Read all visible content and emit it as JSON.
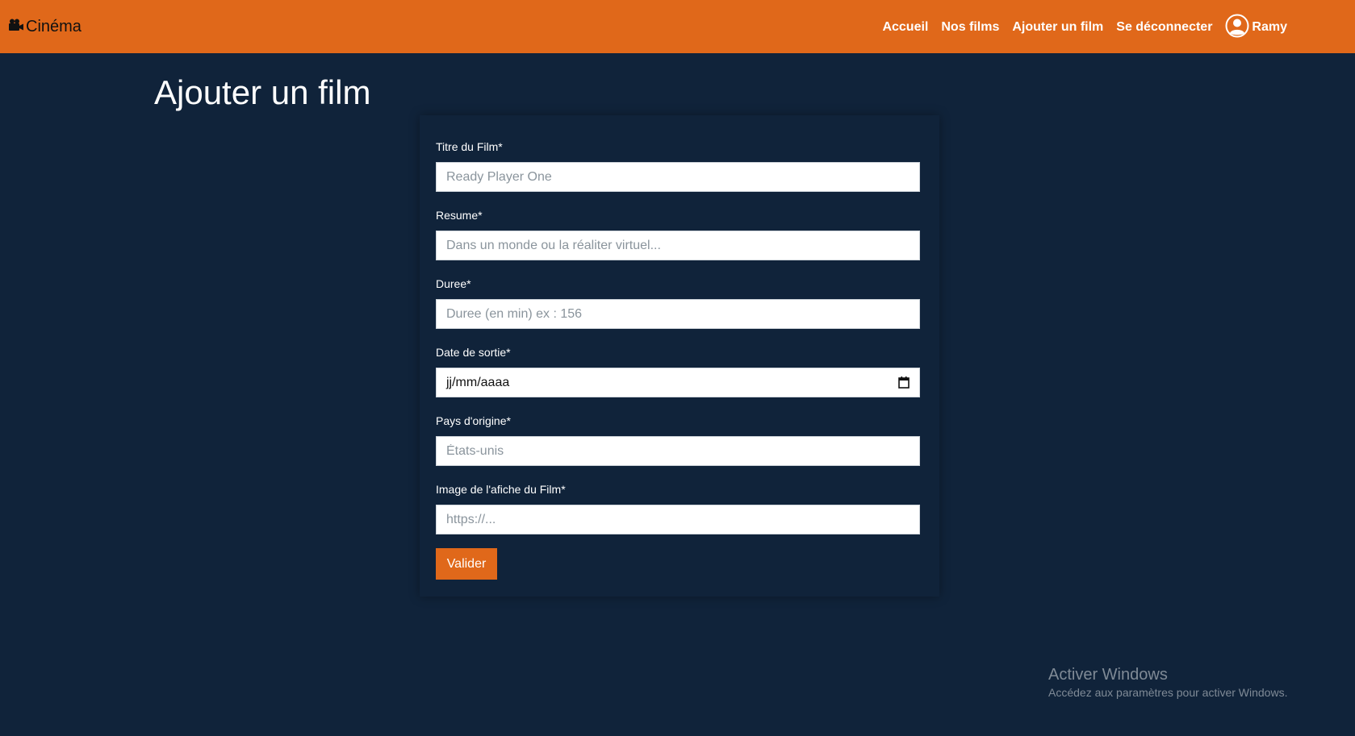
{
  "navbar": {
    "brand": "Cinéma",
    "brand_icon": "video-camera-icon",
    "links": [
      "Accueil",
      "Nos films",
      "Ajouter un film",
      "Se déconnecter"
    ],
    "user_icon": "user-circle-icon",
    "user_name": "Ramy"
  },
  "page": {
    "title": "Ajouter un film"
  },
  "form": {
    "fields": [
      {
        "label": "Titre du Film*",
        "placeholder": "Ready Player One",
        "value": ""
      },
      {
        "label": "Resume*",
        "placeholder": "Dans un monde ou la réaliter virtuel...",
        "value": ""
      },
      {
        "label": "Duree*",
        "placeholder": "Duree (en min) ex : 156",
        "value": ""
      },
      {
        "label": "Date de sortie*",
        "display": "jj/mm/aaaa",
        "icon": "calendar-icon"
      },
      {
        "label": "Pays d'origine*",
        "placeholder": "États-unis",
        "value": ""
      },
      {
        "label": "Image de l'afiche du Film*",
        "placeholder": "https://...",
        "value": ""
      }
    ],
    "submit_label": "Valider"
  },
  "watermark": {
    "title": "Activer Windows",
    "subtitle": "Accédez aux paramètres pour activer Windows."
  },
  "colors": {
    "accent": "#e0681a",
    "background": "#10233a",
    "input_background": "#ffffff"
  }
}
